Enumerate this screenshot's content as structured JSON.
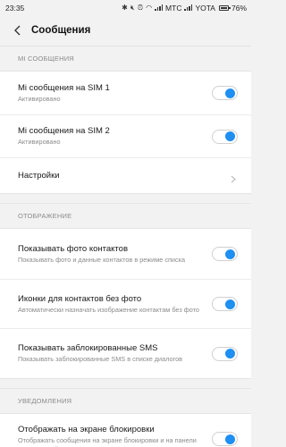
{
  "status_bar": {
    "time": "23:35",
    "carrier1": "MTC",
    "carrier2": "YOTA",
    "battery": "76%",
    "icons": [
      "bluetooth-icon",
      "mute-icon",
      "alarm-icon",
      "wifi-icon",
      "signal-icon",
      "battery-icon"
    ]
  },
  "header": {
    "title": "Сообщения",
    "back_icon": "back-chevron-icon"
  },
  "sections": {
    "mi": {
      "header": "MI СООБЩЕНИЯ",
      "sim1_title": "Mi сообщения на SIM 1",
      "sim1_sub": "Активировано",
      "sim1_on": true,
      "sim2_title": "Mi сообщения на SIM 2",
      "sim2_sub": "Активировано",
      "sim2_on": true,
      "settings_title": "Настройки"
    },
    "display": {
      "header": "ОТОБРАЖЕНИЕ",
      "photos_title": "Показывать фото контактов",
      "photos_sub": "Показывать фото и данные контактов в режиме списка",
      "photos_on": true,
      "icons_title": "Иконки для контактов без фото",
      "icons_sub": "Автоматически назначать изображение контактам без фото",
      "icons_on": true,
      "blocked_title": "Показывать заблокированные SMS",
      "blocked_sub": "Показывать заблокированные SMS в списке диалогов",
      "blocked_on": true
    },
    "notifications": {
      "header": "УВЕДОМЛЕНИЯ",
      "lock_title": "Отображать на экране блокировки",
      "lock_sub": "Отображать сообщения на экране блокировки и на панели уведомлений",
      "lock_on": true
    }
  },
  "colors": {
    "accent": "#1f8ff2",
    "background": "#f2f2f2"
  }
}
